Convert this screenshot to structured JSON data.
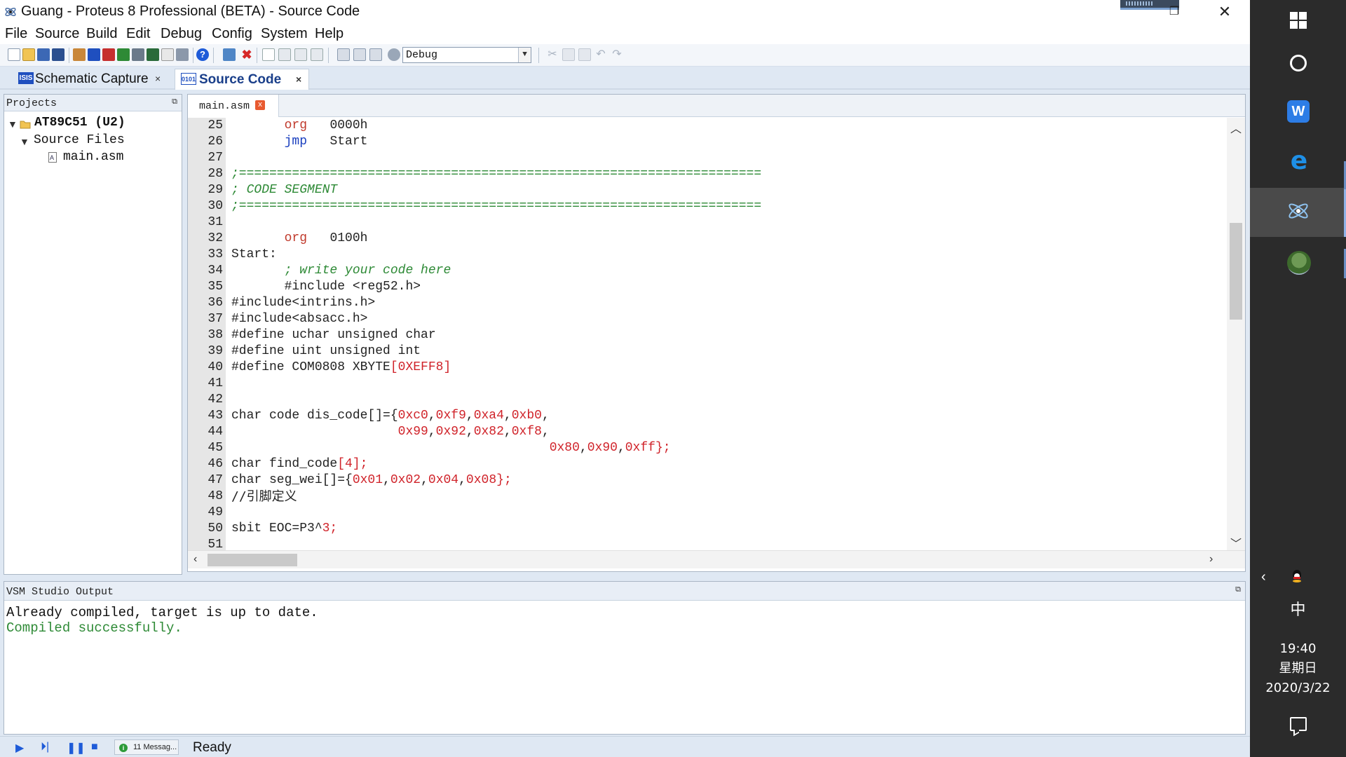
{
  "window": {
    "title": "Guang - Proteus 8 Professional (BETA) - Source Code",
    "close_glyph": "✕",
    "restore_glyph": "❐"
  },
  "menu": [
    "File",
    "Source",
    "Build",
    "Edit",
    "Debug",
    "Config",
    "System",
    "Help"
  ],
  "toolbar": {
    "config_value": "Debug",
    "icons": [
      "new-file-icon",
      "open-folder-icon",
      "save-icon",
      "save-all-icon",
      "home-icon",
      "schematic-icon",
      "pcb-icon",
      "gerber-icon",
      "3d-icon",
      "bom-icon",
      "notes-icon",
      "source-icon",
      "help-icon",
      "import-icon",
      "delete-icon",
      "new-doc-icon",
      "open-doc-icon",
      "build-icon",
      "rebuild-icon",
      "compile-icon",
      "debug-icon",
      "run-icon",
      "cut-icon",
      "copy-icon",
      "paste-icon",
      "undo-icon",
      "redo-icon"
    ]
  },
  "doc_tabs": [
    {
      "label": "Schematic Capture",
      "icon": "ISIS",
      "close": "×"
    },
    {
      "label": "Source Code",
      "icon": "0101",
      "close": "×"
    }
  ],
  "projects": {
    "title": "Projects",
    "root": "AT89C51 (U2)",
    "folder": "Source Files",
    "file": "main.asm"
  },
  "editor": {
    "file_tab": "main.asm",
    "file_tab_close": "x",
    "lines": [
      {
        "n": "25"
      },
      {
        "n": "26"
      },
      {
        "n": "27"
      },
      {
        "n": "28"
      },
      {
        "n": "29"
      },
      {
        "n": "30"
      },
      {
        "n": "31"
      },
      {
        "n": "32"
      },
      {
        "n": "33"
      },
      {
        "n": "34"
      },
      {
        "n": "35"
      },
      {
        "n": "36"
      },
      {
        "n": "37"
      },
      {
        "n": "38"
      },
      {
        "n": "39"
      },
      {
        "n": "40"
      },
      {
        "n": "41"
      },
      {
        "n": "42"
      },
      {
        "n": "43"
      },
      {
        "n": "44"
      },
      {
        "n": "45"
      },
      {
        "n": "46"
      },
      {
        "n": "47"
      },
      {
        "n": "48"
      },
      {
        "n": "49"
      },
      {
        "n": "50"
      },
      {
        "n": "51"
      }
    ],
    "code": {
      "l25_kw": "org",
      "l25_arg": "0000h",
      "l26_kw": "jmp",
      "l26_arg": "Start",
      "l28": ";=====================================================================",
      "l29": "; CODE SEGMENT",
      "l30": ";=====================================================================",
      "l32_kw": "org",
      "l32_arg": "0100h",
      "l33": "Start:",
      "l34": "; write your code here",
      "l35": "#include <reg52.h>",
      "l36": "#include<intrins.h>",
      "l37": "#include<absacc.h>",
      "l38": "#define uchar unsigned char",
      "l39": "#define uint unsigned int",
      "l40_a": "#define COM0808 XBYTE",
      "l40_b": "[0XEFF8]",
      "l43_a": "char code dis_code[]={",
      "l43_b": "0xc0",
      "l43_c": "0xf9",
      "l43_d": "0xa4",
      "l43_e": "0xb0",
      "l44_a": "0x99",
      "l44_b": "0x92",
      "l44_c": "0x82",
      "l44_d": "0xf8",
      "l45_a": "0x80",
      "l45_b": "0x90",
      "l45_c": "0xff",
      "l45_d": "};",
      "l46_a": "char find_code",
      "l46_b": "[4];",
      "l47_a": "char seg_wei[]={",
      "l47_b": "0x01",
      "l47_c": "0x02",
      "l47_d": "0x04",
      "l47_e": "0x08",
      "l47_f": "};",
      "l48": "//引脚定义",
      "l50_a": "sbit EOC=P3^",
      "l50_b": "3;"
    }
  },
  "output": {
    "title": "VSM Studio Output",
    "line1": "Already compiled, target is up to date.",
    "line2": "Compiled successfully."
  },
  "status": {
    "messages": "11 Messag...",
    "ready": "Ready"
  },
  "taskbar": {
    "ime": "中",
    "time": "19:40",
    "weekday": "星期日",
    "date": "2020/3/22"
  },
  "colors": {
    "keyword": "#c0392b",
    "jump": "#1a3fbf",
    "comment": "#2e8a36",
    "number": "#d0232a",
    "taskbar": "#2b2b2b"
  }
}
